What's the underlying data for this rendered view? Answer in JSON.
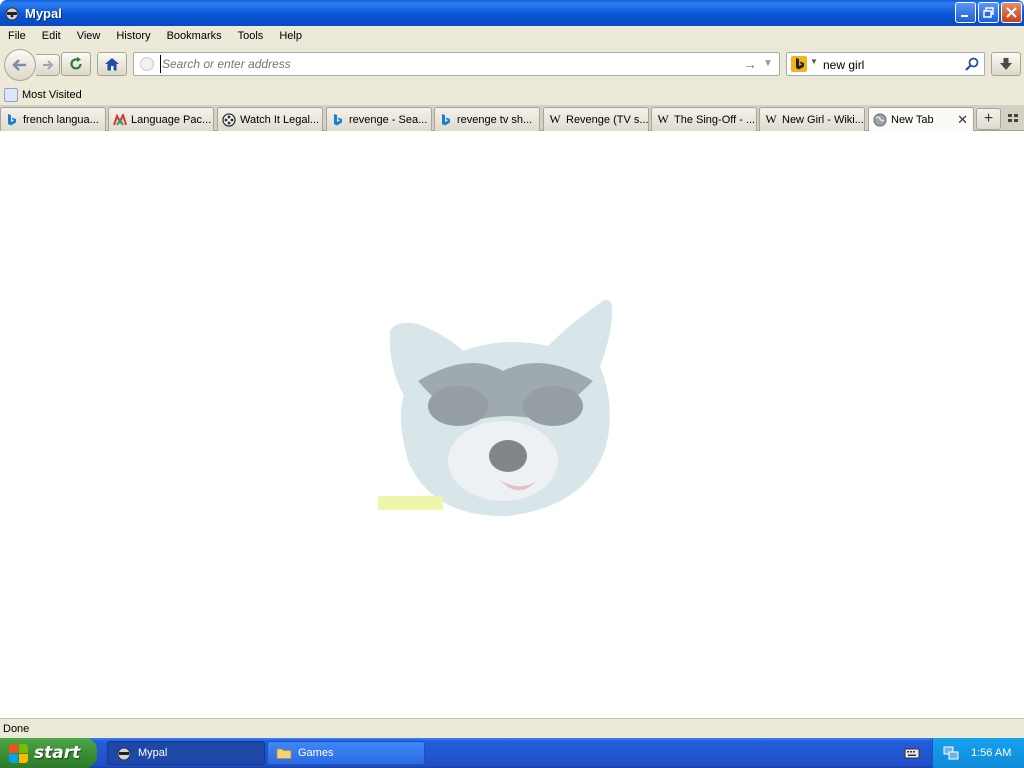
{
  "window": {
    "title": "Mypal",
    "controls": {
      "minimize": "minimize-icon",
      "restore": "restore-icon",
      "close": "close-icon"
    }
  },
  "menu": {
    "items": [
      "File",
      "Edit",
      "View",
      "History",
      "Bookmarks",
      "Tools",
      "Help"
    ]
  },
  "nav": {
    "address_placeholder": "Search or enter address",
    "address_value": "",
    "search_value": "new girl",
    "search_engine_icon": "bing-icon"
  },
  "bookmarks": {
    "items": [
      {
        "label": "Most Visited",
        "icon": "most-visited-icon"
      }
    ]
  },
  "tabs": [
    {
      "label": "french langua...",
      "icon": "bing-icon",
      "active": false
    },
    {
      "label": "Language Pac...",
      "icon": "mypal-icon",
      "active": false
    },
    {
      "label": "Watch It Legal...",
      "icon": "film-reel-icon",
      "active": false
    },
    {
      "label": "revenge - Sea...",
      "icon": "bing-icon",
      "active": false
    },
    {
      "label": "revenge tv sh...",
      "icon": "bing-icon",
      "active": false
    },
    {
      "label": "Revenge (TV s...",
      "icon": "wikipedia-icon",
      "active": false
    },
    {
      "label": "The Sing-Off - ...",
      "icon": "wikipedia-icon",
      "active": false
    },
    {
      "label": "New Girl - Wiki...",
      "icon": "wikipedia-icon",
      "active": false
    },
    {
      "label": "New Tab",
      "icon": "globe-icon",
      "active": true
    }
  ],
  "status": {
    "text": "Done"
  },
  "taskbar": {
    "start_label": "start",
    "tasks": [
      {
        "label": "Mypal",
        "icon": "mypal-icon",
        "active": true
      },
      {
        "label": "Games",
        "icon": "folder-icon",
        "active": false
      }
    ],
    "clock": "1:56 AM"
  },
  "colors": {
    "titlebar": "#0a56d6",
    "chrome": "#ece9d8",
    "taskbar": "#245edb",
    "start": "#3a8f32",
    "tray": "#0f8ad9"
  }
}
